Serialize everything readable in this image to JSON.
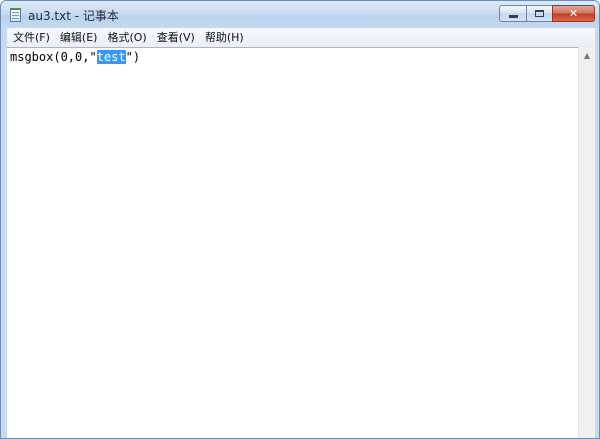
{
  "window": {
    "title": "au3.txt - 记事本",
    "icon": "notepad-icon",
    "minimize_glyph": "minimize-icon",
    "maximize_glyph": "maximize-icon",
    "close_glyph": "✕"
  },
  "menu": {
    "items": [
      "文件(F)",
      "编辑(E)",
      "格式(O)",
      "查看(V)",
      "帮助(H)"
    ]
  },
  "editor": {
    "text_before": "msgbox(0,0,\"",
    "text_selected": "test",
    "text_after": "\")"
  },
  "scrollbar": {
    "up_arrow": "▲"
  },
  "colors": {
    "selection": "#3399ff",
    "close_button": "#c2402a",
    "title_gradient": "#c9dbf1"
  }
}
